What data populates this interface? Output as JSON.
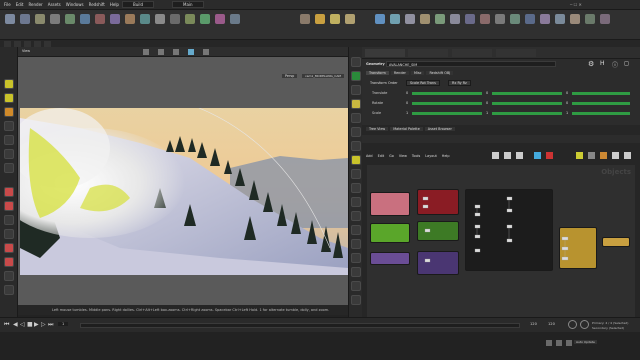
{
  "menu": [
    "File",
    "Edit",
    "Render",
    "Assets",
    "Windows",
    "Redshift",
    "Help"
  ],
  "build_label": "Build",
  "main_label": "Main",
  "view_tab": "View",
  "viewport": {
    "persp_label": "Persp",
    "cam_label": "cam1_MODELLING_CAM"
  },
  "status_text": "Left mouse tumbles. Middle pans. Right dollies. Ctrl+Alt+Left box-zooms. Ctrl+Right zooms. Spacebar Ctrl+Left Hold. 1 for alternate tumble, dolly, and zoom.",
  "param_panel": {
    "node_type": "Geometry",
    "node_name": "AVALANCHE_SIM",
    "tabs": [
      "Transform",
      "Render",
      "Misc",
      "Redshift OBJ"
    ],
    "transform_order_label": "Transform Order",
    "transform_order": "Scale Rot Trans",
    "rotate_order": "Rx Ry Rz",
    "rows": [
      {
        "label": "Translate",
        "values": [
          "0",
          "0",
          "0"
        ]
      },
      {
        "label": "Rotate",
        "values": [
          "0",
          "0",
          "0"
        ]
      },
      {
        "label": "Scale",
        "values": [
          "1",
          "1",
          "1"
        ]
      }
    ]
  },
  "net_tabs": [
    "Tree View",
    "Material Palette",
    "Asset Browser"
  ],
  "net_menu": [
    "Add",
    "Edit",
    "Go",
    "View",
    "Tools",
    "Layout",
    "Help"
  ],
  "net_watermark": "Objects",
  "timeline": {
    "frame": "1",
    "end_frame": "120",
    "end_frame2": "120"
  },
  "bottom_right": {
    "primary": "Primary: 4 / 4 (Selected)",
    "secondary": "Secondary (Selected)",
    "auto_update": "Auto Update"
  },
  "colors": {
    "accent_green": "#2f9b43",
    "node_pink": "#c9707f",
    "node_red": "#8a1c24",
    "node_green": "#5aa62a",
    "node_purple": "#6a4d95",
    "node_yellow": "#b8932f",
    "node_dark": "#1c1c1c"
  }
}
